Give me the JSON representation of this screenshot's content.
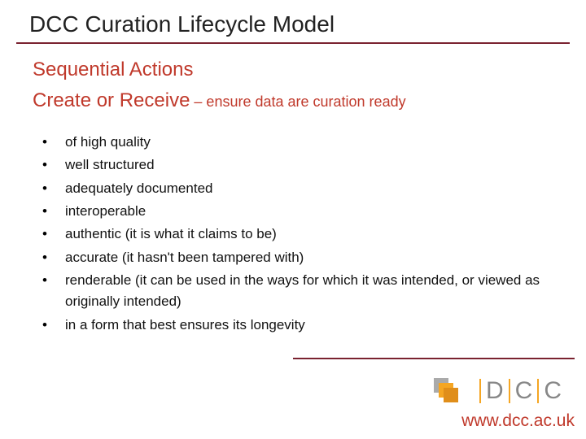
{
  "title": "DCC Curation Lifecycle Model",
  "section_heading": "Sequential Actions",
  "subsection": {
    "lead": "Create or Receive",
    "tail": " – ensure data are curation ready"
  },
  "bullets": [
    "of high quality",
    "well structured",
    "adequately documented",
    "interoperable",
    "authentic (it is what it claims to be)",
    "accurate (it hasn't been tampered with)",
    "renderable (it can be used in the ways for which it was intended, or viewed as originally intended)",
    "in a form that best ensures its longevity"
  ],
  "logo": {
    "letters": [
      "D",
      "C",
      "C"
    ]
  },
  "url": "www.dcc.ac.uk"
}
